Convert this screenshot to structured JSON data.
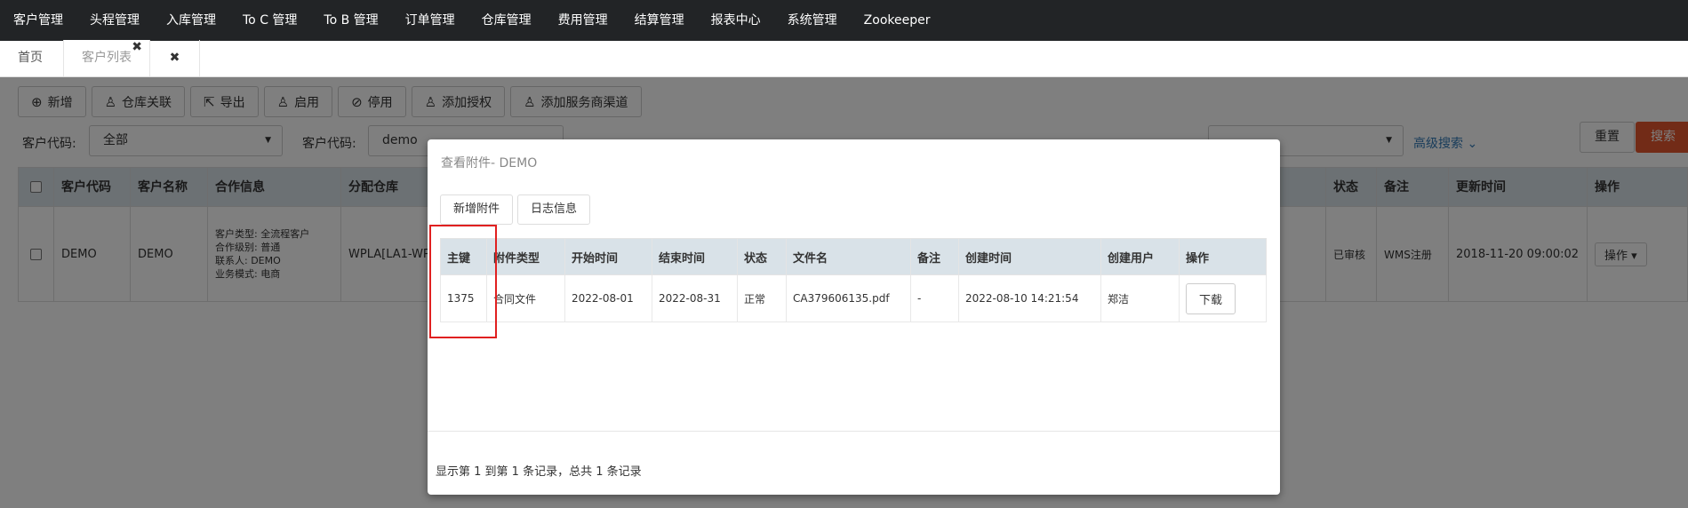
{
  "topnav": {
    "items": [
      "客户管理",
      "头程管理",
      "入库管理",
      "To C 管理",
      "To B 管理",
      "订单管理",
      "仓库管理",
      "费用管理",
      "结算管理",
      "报表中心",
      "系统管理",
      "Zookeeper"
    ]
  },
  "tabs": {
    "home": "首页",
    "current": "客户列表",
    "close_glyph": "✖",
    "closeall_glyph": "✖"
  },
  "toolbar": {
    "buttons": [
      {
        "label": "新增",
        "icon": "plus-circle-icon"
      },
      {
        "label": "仓库关联",
        "icon": "user-icon"
      },
      {
        "label": "导出",
        "icon": "export-icon"
      },
      {
        "label": "启用",
        "icon": "user-icon"
      },
      {
        "label": "停用",
        "icon": "ban-icon"
      },
      {
        "label": "添加授权",
        "icon": "user-icon"
      },
      {
        "label": "添加服务商渠道",
        "icon": "user-icon"
      }
    ]
  },
  "filters": {
    "label1": "客户代码:",
    "select1_value": "全部",
    "label2": "客户代码:",
    "input2_value": "demo",
    "advanced": "高级搜索",
    "reset": "重置",
    "search": "搜索"
  },
  "grid": {
    "headers": [
      "客户代码",
      "客户名称",
      "合作信息",
      "分配仓库",
      "状态",
      "备注",
      "更新时间",
      "操作"
    ],
    "row": {
      "code": "DEMO",
      "name": "DEMO",
      "coop": [
        "客户类型: 全流程客户",
        "合作级别: 普通",
        "联系人: DEMO",
        "业务模式: 电商"
      ],
      "warehouse": "WPLA[LA1-WP]",
      "status": "已审核",
      "remark": "WMS注册",
      "updated": "2018-11-20 09:00:02",
      "op": "操作"
    }
  },
  "modal": {
    "title": "查看附件- DEMO",
    "add_attachment": "新增附件",
    "log_info": "日志信息",
    "headers": [
      "主键",
      "附件类型",
      "开始时间",
      "结束时间",
      "状态",
      "文件名",
      "备注",
      "创建时间",
      "创建用户",
      "操作"
    ],
    "rows": [
      {
        "id": "1375",
        "type": "合同文件",
        "start": "2022-08-01",
        "end": "2022-08-31",
        "status": "正常",
        "file": "CA379606135.pdf",
        "remark": "-",
        "created": "2022-08-10 14:21:54",
        "user": "郑洁",
        "action": "下载"
      }
    ],
    "footer": "显示第 1 到第 1 条记录，总共 1 条记录"
  },
  "colors": {
    "nav_bg": "#222426",
    "header_bg": "#d9e2e8",
    "search_btn": "#e4572e",
    "highlight": "#e02020",
    "link": "#337ab7"
  }
}
